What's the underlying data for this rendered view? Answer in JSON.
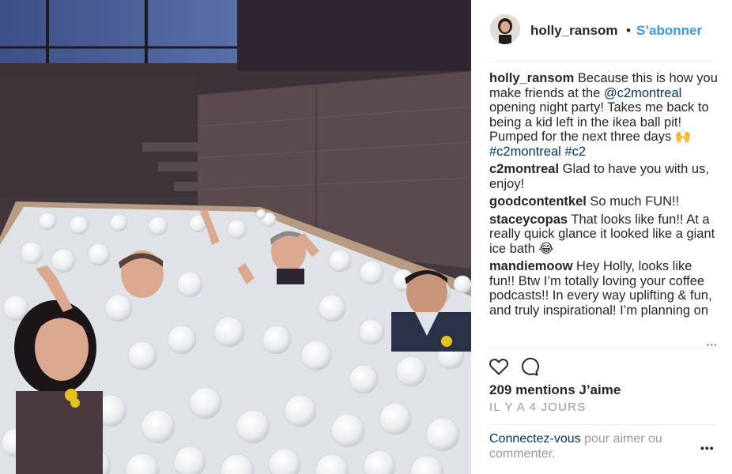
{
  "photo": {
    "alt": "Group of people sitting in a ball pit full of white balls"
  },
  "header": {
    "username": "holly_ransom",
    "dot": "•",
    "follow_label": "S’abonner"
  },
  "comments": [
    {
      "user": "holly_ransom",
      "parts": [
        {
          "t": "text",
          "v": " Because this is how you make friends at the "
        },
        {
          "t": "tag",
          "v": "@c2montreal"
        },
        {
          "t": "text",
          "v": " opening night party! Takes me back to being a kid left in the ikea ball pit! Pumped for the next three days "
        },
        {
          "t": "text",
          "v": "🙌"
        },
        {
          "t": "tag",
          "v": "#c2montreal"
        },
        {
          "t": "text",
          "v": " "
        },
        {
          "t": "tag",
          "v": "#c2"
        }
      ]
    },
    {
      "user": "c2montreal",
      "parts": [
        {
          "t": "text",
          "v": " Glad to have you with us, enjoy!"
        }
      ]
    },
    {
      "user": "goodcontentkel",
      "parts": [
        {
          "t": "text",
          "v": " So much FUN!!"
        }
      ]
    },
    {
      "user": "staceycopas",
      "parts": [
        {
          "t": "text",
          "v": " That looks like fun!! At a really quick glance it looked like a giant ice bath 😂"
        }
      ]
    },
    {
      "user": "mandiemoow",
      "parts": [
        {
          "t": "text",
          "v": " Hey Holly, looks like fun!! Btw I’m totally loving your coffee podcasts!! In every way uplifting & fun, and truly inspirational! I’m planning on"
        }
      ]
    }
  ],
  "actions": {
    "like_icon": "heart-icon",
    "comment_icon": "comment-icon"
  },
  "likes_text": "209 mentions J’aime",
  "date_text": "IL Y A 4 JOURS",
  "login": {
    "link": "Connectez-vous",
    "rest": " pour aimer ou commenter."
  },
  "options_label": "•••",
  "colors": {
    "link": "#003569",
    "follow": "#3897f0",
    "muted": "#999999",
    "text": "#262626"
  }
}
